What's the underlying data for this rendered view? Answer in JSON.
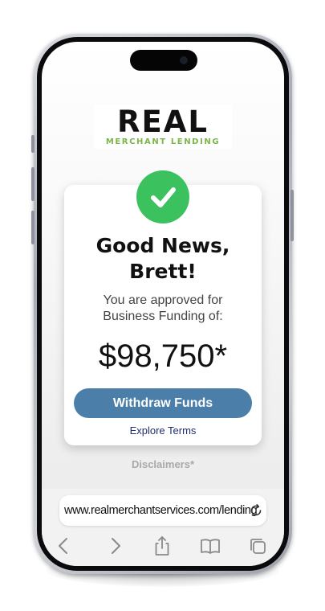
{
  "logo": {
    "word": "REAL",
    "tagline": "MERCHANT LENDING"
  },
  "card": {
    "headline_line1": "Good News,",
    "headline_line2": "Brett!",
    "subline_line1": "You are approved for",
    "subline_line2": "Business Funding of:",
    "amount": "$98,750*",
    "withdraw_label": "Withdraw Funds",
    "explore_label": "Explore Terms"
  },
  "disclaimers_label": "Disclaimers*",
  "browser": {
    "url": "www.realmerchantservices.com/lending",
    "toolbar_icons": [
      "back-icon",
      "forward-icon",
      "share-icon",
      "bookmarks-icon",
      "tabs-icon"
    ]
  },
  "colors": {
    "success_green": "#3cc15f",
    "button_blue": "#4b7ea8",
    "link_navy": "#1f2f6e",
    "logo_green": "#7ab648"
  }
}
